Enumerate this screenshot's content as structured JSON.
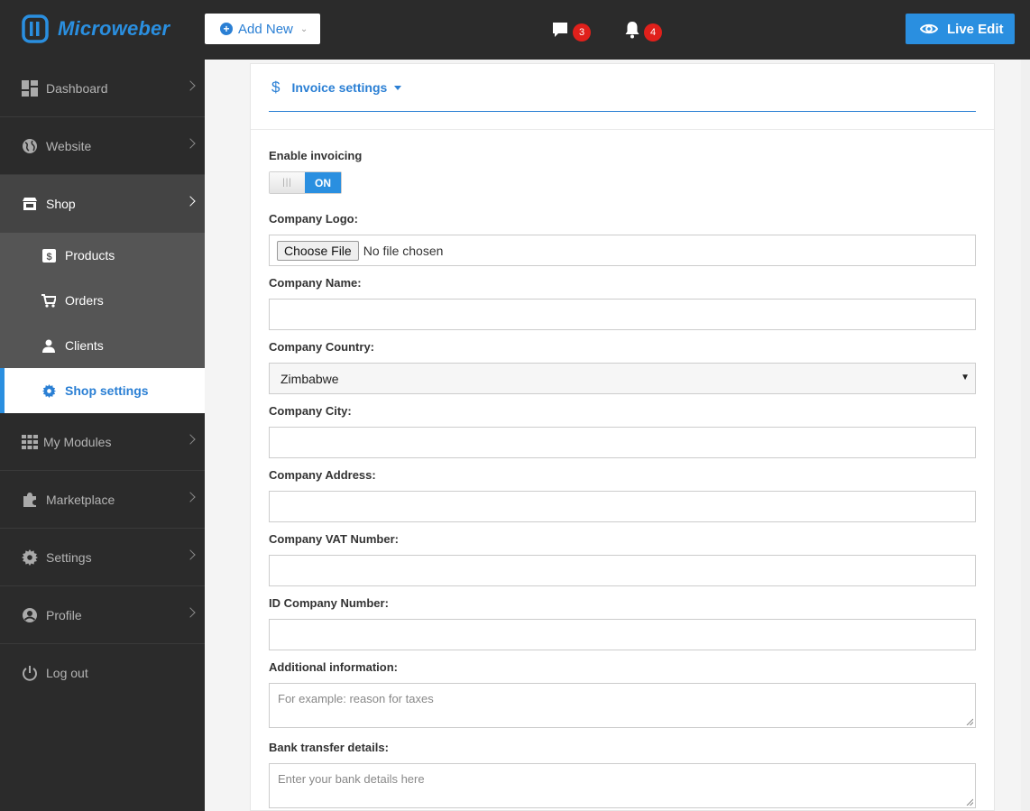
{
  "brand": {
    "name": "Microweber",
    "color": "#2a8fe0"
  },
  "topbar": {
    "add_new_label": "Add New",
    "comments_count": "3",
    "notifications_count": "4",
    "live_edit_label": "Live Edit"
  },
  "sidebar": {
    "items": [
      {
        "label": "Dashboard",
        "icon": "dashboard-icon"
      },
      {
        "label": "Website",
        "icon": "globe-icon"
      },
      {
        "label": "Shop",
        "icon": "store-icon"
      },
      {
        "label": "My Modules",
        "icon": "grid-icon"
      },
      {
        "label": "Marketplace",
        "icon": "puzzle-icon"
      },
      {
        "label": "Settings",
        "icon": "gear-icon"
      },
      {
        "label": "Profile",
        "icon": "user-circle-icon"
      },
      {
        "label": "Log out",
        "icon": "power-icon"
      }
    ],
    "shop_sub": [
      {
        "label": "Products",
        "icon": "product-icon"
      },
      {
        "label": "Orders",
        "icon": "cart-icon"
      },
      {
        "label": "Clients",
        "icon": "person-icon"
      },
      {
        "label": "Shop settings",
        "icon": "gear-icon"
      }
    ]
  },
  "panel": {
    "title": "Invoice settings",
    "enable_invoicing_label": "Enable invoicing",
    "toggle_on": "ON",
    "toggle_handle": "|||",
    "company_logo_label": "Company Logo:",
    "file_button": "Choose File",
    "file_status": "No file chosen",
    "company_name_label": "Company Name:",
    "company_name_value": "",
    "company_country_label": "Company Country:",
    "company_country_value": "Zimbabwe",
    "company_city_label": "Company City:",
    "company_city_value": "",
    "company_address_label": "Company Address:",
    "company_address_value": "",
    "company_vat_label": "Company VAT Number:",
    "company_vat_value": "",
    "id_company_label": "ID Company Number:",
    "id_company_value": "",
    "additional_info_label": "Additional information:",
    "additional_info_placeholder": "For example: reason for taxes",
    "bank_transfer_label": "Bank transfer details:",
    "bank_transfer_placeholder": "Enter your bank details here"
  }
}
